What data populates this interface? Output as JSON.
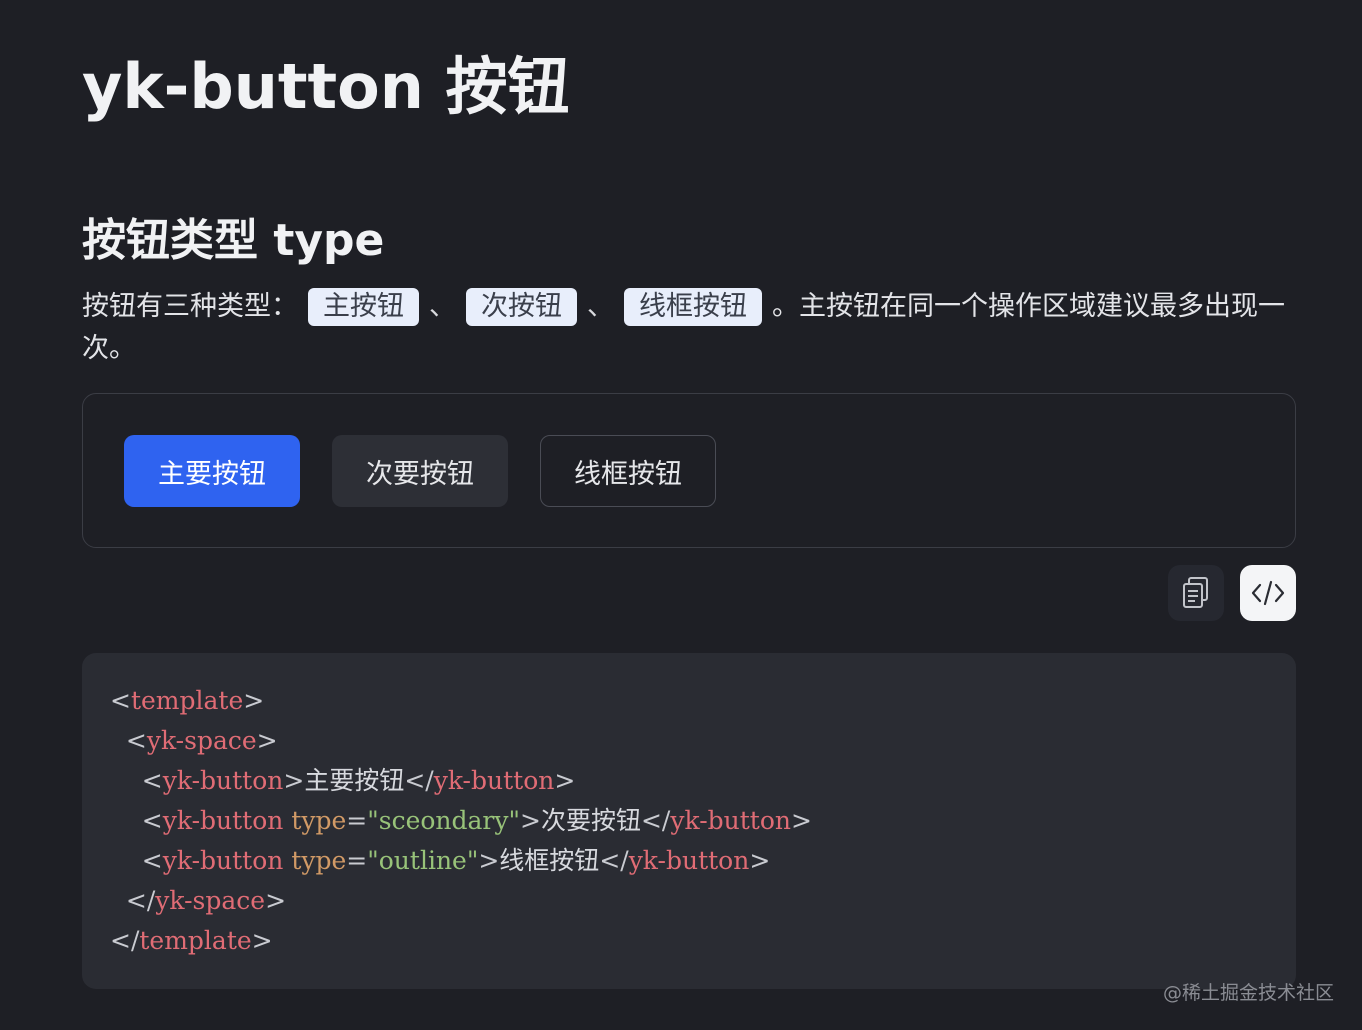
{
  "page": {
    "title": "yk-button 按钮"
  },
  "section": {
    "title": "按钮类型 type",
    "desc_prefix": "按钮有三种类型：",
    "chips": [
      "主按钮",
      "次按钮",
      "线框按钮"
    ],
    "separator": "、",
    "desc_suffix": "。主按钮在同一个操作区域建议最多出现一次。"
  },
  "demo": {
    "primary_label": "主要按钮",
    "secondary_label": "次要按钮",
    "outline_label": "线框按钮"
  },
  "toolbar": {
    "copy_icon": "copy-icon",
    "code_icon": "code-icon"
  },
  "code": {
    "lines": [
      [
        [
          "punct",
          "<"
        ],
        [
          "tag",
          "template"
        ],
        [
          "punct",
          ">"
        ]
      ],
      [
        [
          "punct",
          "  <"
        ],
        [
          "tag",
          "yk-space"
        ],
        [
          "punct",
          ">"
        ]
      ],
      [
        [
          "punct",
          "    <"
        ],
        [
          "tag",
          "yk-button"
        ],
        [
          "punct",
          ">"
        ],
        [
          "text",
          "主要按钮"
        ],
        [
          "punct",
          "</"
        ],
        [
          "tag",
          "yk-button"
        ],
        [
          "punct",
          ">"
        ]
      ],
      [
        [
          "punct",
          "    <"
        ],
        [
          "tag",
          "yk-button"
        ],
        [
          "punct",
          " "
        ],
        [
          "attr",
          "type"
        ],
        [
          "punct",
          "="
        ],
        [
          "str",
          "\"sceondary\""
        ],
        [
          "punct",
          ">"
        ],
        [
          "text",
          "次要按钮"
        ],
        [
          "punct",
          "</"
        ],
        [
          "tag",
          "yk-button"
        ],
        [
          "punct",
          ">"
        ]
      ],
      [
        [
          "punct",
          "    <"
        ],
        [
          "tag",
          "yk-button"
        ],
        [
          "punct",
          " "
        ],
        [
          "attr",
          "type"
        ],
        [
          "punct",
          "="
        ],
        [
          "str",
          "\"outline\""
        ],
        [
          "punct",
          ">"
        ],
        [
          "text",
          "线框按钮"
        ],
        [
          "punct",
          "</"
        ],
        [
          "tag",
          "yk-button"
        ],
        [
          "punct",
          ">"
        ]
      ],
      [
        [
          "punct",
          "  </"
        ],
        [
          "tag",
          "yk-space"
        ],
        [
          "punct",
          ">"
        ]
      ],
      [
        [
          "punct",
          "</"
        ],
        [
          "tag",
          "template"
        ],
        [
          "punct",
          ">"
        ]
      ]
    ]
  },
  "watermark": "@稀土掘金技术社区",
  "colors": {
    "background": "#1e1f25",
    "primary": "#2f63f0",
    "tag": "#e06c75",
    "attr": "#d19a66",
    "string": "#98c379"
  }
}
